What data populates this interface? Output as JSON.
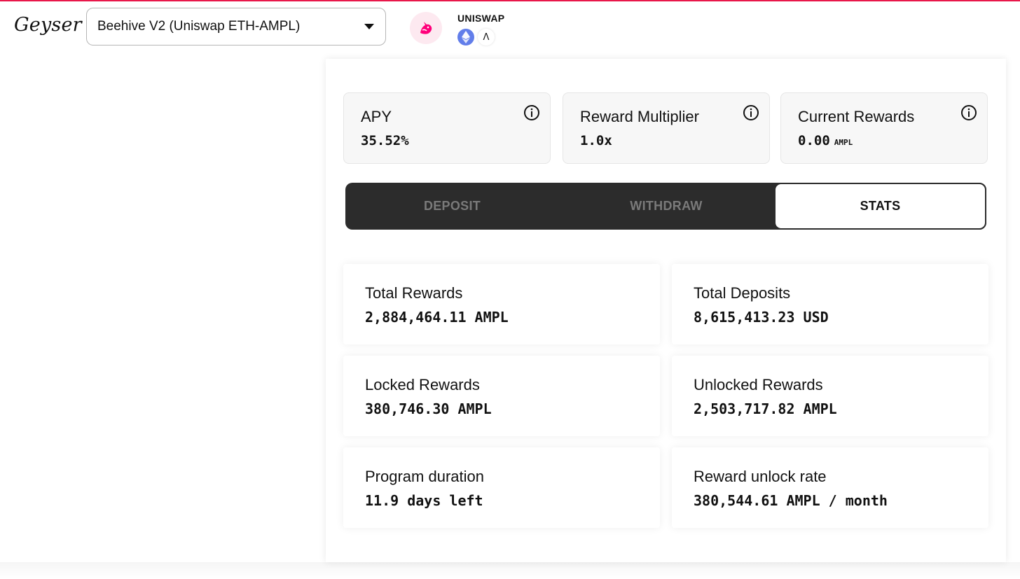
{
  "brand": "Geyser",
  "selector": {
    "value": "Beehive V2 (Uniswap ETH-AMPL)"
  },
  "platform": {
    "name": "UNISWAP",
    "tokens": [
      "ETH",
      "AMPL"
    ],
    "ampl_symbol": "Λ"
  },
  "info_cards": [
    {
      "label": "APY",
      "value": "35.52%",
      "unit": ""
    },
    {
      "label": "Reward Multiplier",
      "value": "1.0x",
      "unit": ""
    },
    {
      "label": "Current Rewards",
      "value": "0.00",
      "unit": "AMPL"
    }
  ],
  "tabs": [
    {
      "label": "DEPOSIT",
      "active": false
    },
    {
      "label": "WITHDRAW",
      "active": false
    },
    {
      "label": "STATS",
      "active": true
    }
  ],
  "stats": [
    {
      "label": "Total Rewards",
      "value": "2,884,464.11 AMPL"
    },
    {
      "label": "Total Deposits",
      "value": "8,615,413.23 USD"
    },
    {
      "label": "Locked Rewards",
      "value": "380,746.30 AMPL"
    },
    {
      "label": "Unlocked Rewards",
      "value": "2,503,717.82 AMPL"
    },
    {
      "label": "Program duration",
      "value": "11.9 days left"
    },
    {
      "label": "Reward unlock rate",
      "value": "380,544.61 AMPL / month"
    }
  ],
  "colors": {
    "accent": "#e8174a",
    "tab_bg": "#2c2c2c",
    "eth": "#627eea",
    "uniswap_pink": "#ff007a"
  }
}
